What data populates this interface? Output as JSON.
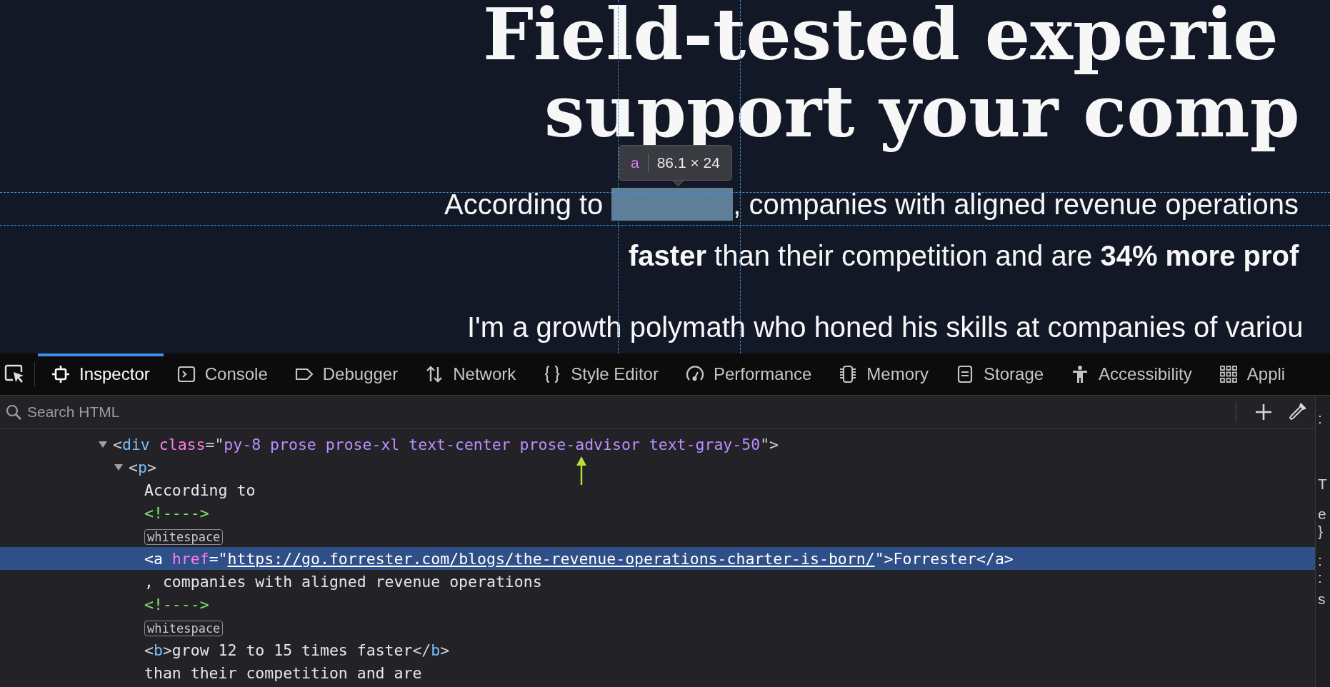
{
  "page": {
    "headline": [
      "Field-tested experie",
      "support your comp"
    ],
    "paragraph": {
      "before": "According to",
      "after": ", companies with aligned revenue operations",
      "line_2": "**faster** than their competition and are **34% more prof**",
      "line_3": "I'm a growth polymath who honed his skills at companies of variou"
    },
    "tooltip": {
      "tag": "a",
      "size": "86.1 × 24"
    }
  },
  "toolbar": {
    "tabs": [
      {
        "label": "Inspector",
        "selected": true
      },
      {
        "label": "Console",
        "selected": false
      },
      {
        "label": "Debugger",
        "selected": false
      },
      {
        "label": "Network",
        "selected": false
      },
      {
        "label": "Style Editor",
        "selected": false
      },
      {
        "label": "Performance",
        "selected": false
      },
      {
        "label": "Memory",
        "selected": false
      },
      {
        "label": "Storage",
        "selected": false
      },
      {
        "label": "Accessibility",
        "selected": false
      },
      {
        "label": "Appli",
        "selected": false
      }
    ]
  },
  "search": {
    "placeholder": "Search HTML"
  },
  "tree": [
    {
      "expanded": true,
      "selected": false,
      "tokens": [
        {
          "kind": "punct",
          "text": "<"
        },
        {
          "kind": "tag",
          "text": "div"
        },
        {
          "kind": "attr",
          "text": " class"
        },
        {
          "kind": "punct",
          "text": "=\""
        },
        {
          "kind": "value",
          "text": "py-8 prose prose-xl text-center prose-advisor text-gray-50"
        },
        {
          "kind": "punct",
          "text": "\">"
        }
      ],
      "children": [
        {
          "expanded": true,
          "selected": false,
          "tokens": [
            {
              "kind": "punct",
              "text": "<"
            },
            {
              "kind": "tag",
              "text": "p"
            },
            {
              "kind": "punct",
              "text": ">"
            }
          ],
          "children": [
            {
              "selected": false,
              "tokens": [
                {
                  "kind": "text",
                  "text": "According to"
                }
              ]
            },
            {
              "selected": false,
              "tokens": [
                {
                  "kind": "comment",
                  "text": "<!---->"
                }
              ]
            },
            {
              "selected": false,
              "tokens": [
                {
                  "kind": "badge",
                  "text": "whitespace"
                }
              ]
            },
            {
              "selected": true,
              "tokens": [
                {
                  "kind": "punct",
                  "text": "<"
                },
                {
                  "kind": "tag",
                  "text": "a"
                },
                {
                  "kind": "attr",
                  "text": " href"
                },
                {
                  "kind": "punct",
                  "text": "=\""
                },
                {
                  "kind": "url",
                  "text": "https://go.forrester.com/blogs/the-revenue-operations-charter-is-born/"
                },
                {
                  "kind": "punct",
                  "text": "\">"
                },
                {
                  "kind": "text",
                  "text": "Forrester"
                },
                {
                  "kind": "punct",
                  "text": "</"
                },
                {
                  "kind": "tag",
                  "text": "a"
                },
                {
                  "kind": "punct",
                  "text": ">"
                }
              ]
            },
            {
              "selected": false,
              "tokens": [
                {
                  "kind": "text",
                  "text": ", companies with aligned revenue operations"
                }
              ]
            },
            {
              "selected": false,
              "tokens": [
                {
                  "kind": "comment",
                  "text": "<!---->"
                }
              ]
            },
            {
              "selected": false,
              "tokens": [
                {
                  "kind": "badge",
                  "text": "whitespace"
                }
              ]
            },
            {
              "selected": false,
              "tokens": [
                {
                  "kind": "punct",
                  "text": "<"
                },
                {
                  "kind": "tag",
                  "text": "b"
                },
                {
                  "kind": "punct",
                  "text": ">"
                },
                {
                  "kind": "text",
                  "text": "grow 12 to 15 times faster"
                },
                {
                  "kind": "punct",
                  "text": "</"
                },
                {
                  "kind": "tag",
                  "text": "b"
                },
                {
                  "kind": "punct",
                  "text": ">"
                }
              ]
            },
            {
              "selected": false,
              "tokens": [
                {
                  "kind": "text",
                  "text": "than their competition and are"
                }
              ]
            }
          ]
        }
      ]
    }
  ],
  "side_panel": {
    "fragments": [
      ":",
      "T",
      "e",
      "}",
      ":",
      ":",
      "s"
    ]
  }
}
